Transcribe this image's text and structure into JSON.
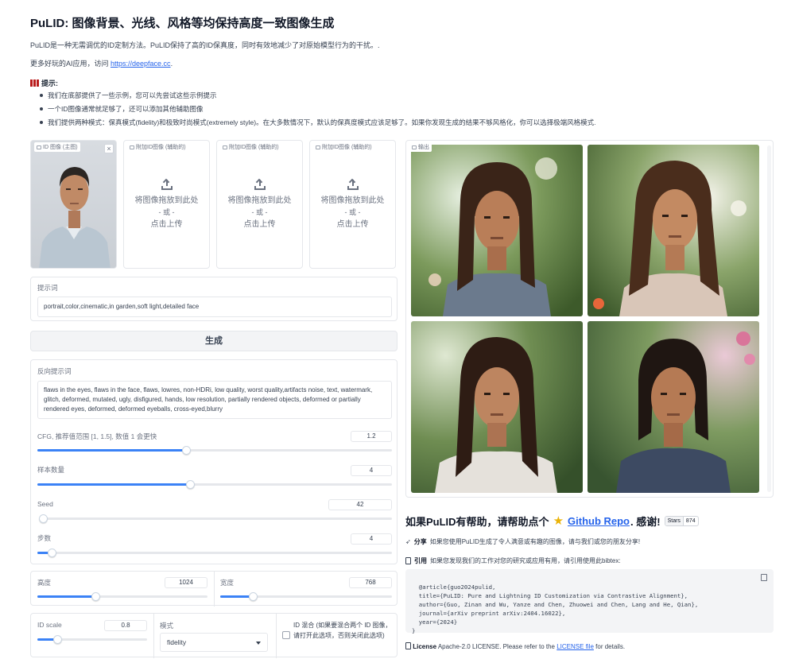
{
  "header": {
    "title": "PuLID: 图像背景、光线、风格等均保持高度一致图像生成",
    "description": "PuLID是一种无需调优的ID定制方法。PuLID保持了高的ID保真度，同时有效地减少了对原始模型行为的干扰。.",
    "more_apps_prefix": "更多好玩的AI应用，访问 ",
    "more_apps_link": "https://deepface.cc",
    "more_apps_suffix": "."
  },
  "tips": {
    "heading": "提示:",
    "items": [
      "我们在底部提供了一些示例，您可以先尝试这些示例提示",
      "一个ID图像通常就足够了，还可以添加其他辅助图像",
      "我们提供两种模式：保真模式(fidelity)和极致时尚模式(extremely style)。在大多数情况下，默认的保真度模式应该足够了。如果你发现生成的结果不够风格化，你可以选择极端风格模式."
    ]
  },
  "uploads": {
    "main_label": "ID 图像 (主图)",
    "close": "×",
    "aux_label": "附加ID图像 (辅助的)",
    "drop_text": "将图像拖放到此处",
    "or_text": "- 或 -",
    "click_text": "点击上传"
  },
  "prompt": {
    "label": "提示词",
    "value": "portrait,color,cinematic,in garden,soft light,detailed face"
  },
  "generate_button": "生成",
  "negative_prompt": {
    "label": "反向提示词",
    "value": "flaws in the eyes, flaws in the face, flaws, lowres, non-HDRi, low quality, worst quality,artifacts noise, text, watermark, glitch, deformed, mutated, ugly, disfigured, hands, low resolution, partially rendered objects,  deformed or partially rendered eyes, deformed, deformed eyeballs, cross-eyed,blurry"
  },
  "sliders": {
    "cfg": {
      "label": "CFG, 推荐值范围 [1, 1.5], 数值 1 会更快",
      "value": "1.2",
      "fraction": 0.42
    },
    "samples": {
      "label": "样本数量",
      "value": "4",
      "fraction": 0.43
    },
    "seed": {
      "label": "Seed",
      "value": "42",
      "fraction": 0.0
    },
    "steps": {
      "label": "步数",
      "value": "4",
      "fraction": 0.04
    },
    "height": {
      "label": "高度",
      "value": "1024",
      "fraction": 0.34
    },
    "width": {
      "label": "宽度",
      "value": "768",
      "fraction": 0.19
    },
    "id_scale": {
      "label": "ID scale",
      "value": "0.8",
      "fraction": 0.18
    }
  },
  "mode": {
    "label": "模式",
    "selected": "fidelity"
  },
  "id_mix": {
    "label": "ID 混合 (如果要混合两个 ID 图像，请打开此选项，否则关闭此选项)",
    "checked": false
  },
  "output": {
    "label": "输出"
  },
  "thanks": {
    "prefix": "如果PuLID有帮助，请帮助点个",
    "link": "Github Repo",
    "suffix": ". 感谢!",
    "stars_label": "Stars",
    "stars_count": "874"
  },
  "share": {
    "bold": "分享",
    "text": "如果您使用PuLID生成了令人满意或有趣的图像，请与我们或您的朋友分享!"
  },
  "cite": {
    "bold": "引用",
    "text": "如果您发现我们的工作对您的研究或应用有用，请引用使用此bibtex:"
  },
  "bibtex": "@article{guo2024pulid,\n  title={PuLID: Pure and Lightning ID Customization via Contrastive Alignment},\n  author={Guo, Zinan and Wu, Yanze and Chen, Zhuowei and Chen, Lang and He, Qian},\n  journal={arXiv preprint arXiv:2404.16022},\n  year={2024}\n}",
  "license": {
    "bold": "License",
    "text": " Apache-2.0 LICENSE. Please refer to the ",
    "link": "LICENSE file",
    "suffix": " for details."
  }
}
